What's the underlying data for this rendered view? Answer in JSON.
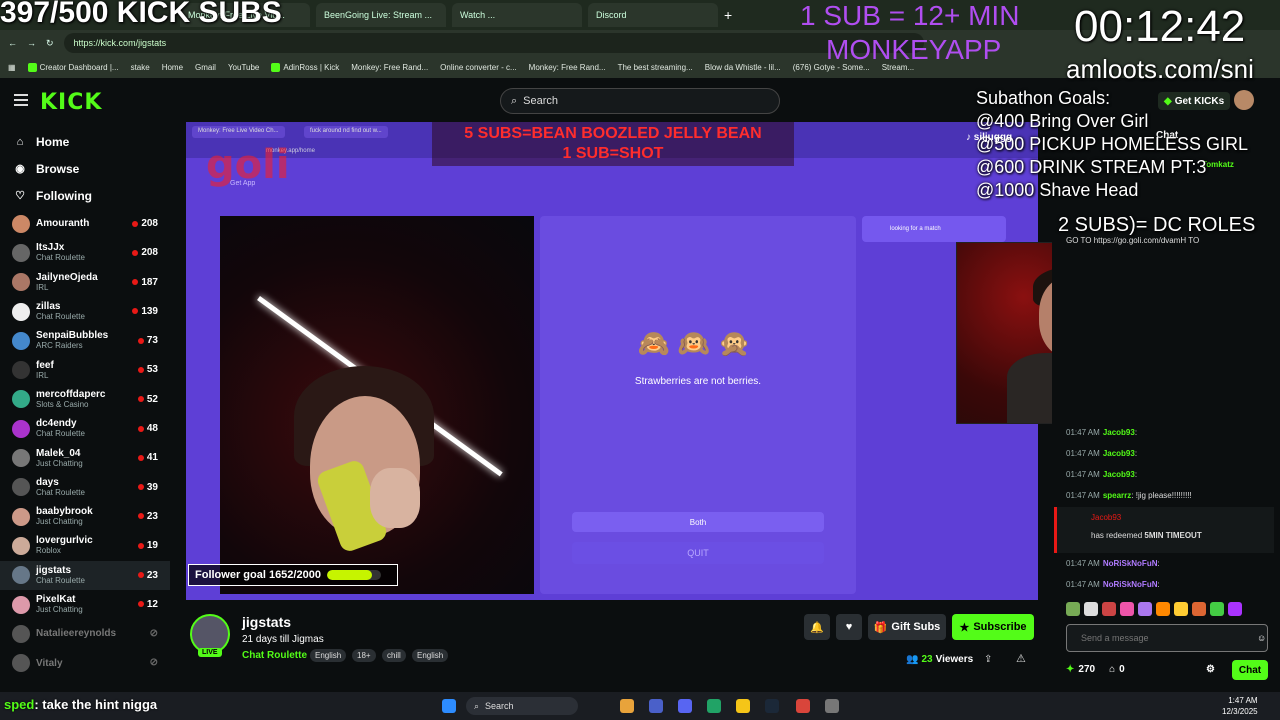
{
  "browser": {
    "tabs": [
      "Monkey: Free Live Vid...",
      "BeenGoing Live: Stream ...",
      "Watch ...",
      "Discord"
    ],
    "url": "https://kick.com/jigstats",
    "bookmarks": [
      "Creator Dashboard |...",
      "stake",
      "Home",
      "Gmail",
      "YouTube",
      "AdinRoss | Kick",
      "Monkey: Free Rand...",
      "Online converter - c...",
      "Monkey: Free Rand...",
      "The best streaming...",
      "Blow da Whistle - lil...",
      "(676) Gotye - Some...",
      "Stream..."
    ]
  },
  "overlay": {
    "sub_counter": "397/500 KICK SUBS",
    "sub_rule_line1": "1 SUB = 12+ MIN",
    "sub_rule_line2": "MONKEYAPP",
    "timer": "00:12:42",
    "site": "amloots.com/sni",
    "goals_title": "Subathon Goals:",
    "goals": [
      "@400 Bring Over Girl",
      "@500 PICKUP HOMELESS GIRL",
      "@600 DRINK STREAM PT:3",
      "@1000 Shave Head"
    ],
    "dc_roles": "2 SUBS)= DC ROLES",
    "red_line1": "5 SUBS=BEAN BOOZLED JELLY BEAN",
    "red_line2": "1 SUB=SHOT",
    "goli": "goli",
    "follower_goal": "Follower goal 1652/2000",
    "follower_progress": 0.826,
    "bottom_chat_user": "sped",
    "bottom_chat_msg": ": take the hint nigga"
  },
  "topnav": {
    "logo": "KICK",
    "search_placeholder": "Search",
    "get_kicks": "Get KICKs"
  },
  "sidebar": {
    "nav": [
      {
        "label": "Home",
        "icon": "⌂"
      },
      {
        "label": "Browse",
        "icon": "◉"
      },
      {
        "label": "Following",
        "icon": "♡"
      }
    ],
    "channels": [
      {
        "name": "Amouranth",
        "cat": "",
        "viewers": "208",
        "color": "#c86"
      },
      {
        "name": "ItsJJx",
        "cat": "Chat Roulette",
        "viewers": "208",
        "color": "#666"
      },
      {
        "name": "JailyneOjeda",
        "cat": "IRL",
        "viewers": "187",
        "color": "#a76"
      },
      {
        "name": "zillas",
        "cat": "Chat Roulette",
        "viewers": "139",
        "color": "#eee"
      },
      {
        "name": "SenpaiBubbles",
        "cat": "ARC Raiders",
        "viewers": "73",
        "color": "#48c"
      },
      {
        "name": "feef",
        "cat": "IRL",
        "viewers": "53",
        "color": "#333"
      },
      {
        "name": "mercoffdaperc",
        "cat": "Slots & Casino",
        "viewers": "52",
        "color": "#3a8"
      },
      {
        "name": "dc4endy",
        "cat": "Chat Roulette",
        "viewers": "48",
        "color": "#a3c"
      },
      {
        "name": "Malek_04",
        "cat": "Just Chatting",
        "viewers": "41",
        "color": "#777"
      },
      {
        "name": "days",
        "cat": "Chat Roulette",
        "viewers": "39",
        "color": "#555"
      },
      {
        "name": "baabybrook",
        "cat": "Just Chatting",
        "viewers": "23",
        "color": "#c98"
      },
      {
        "name": "lovergurlvic",
        "cat": "Roblox",
        "viewers": "19",
        "color": "#ca9"
      },
      {
        "name": "jigstats",
        "cat": "Chat Roulette",
        "viewers": "23",
        "color": "#678"
      },
      {
        "name": "PixelKat",
        "cat": "Just Chatting",
        "viewers": "12",
        "color": "#d9a"
      },
      {
        "name": "Natalieereynolds",
        "cat": "",
        "viewers": "",
        "color": "#555"
      },
      {
        "name": "Vitaly",
        "cat": "",
        "viewers": "",
        "color": "#555"
      }
    ]
  },
  "player": {
    "inner_tabs": [
      "Monkey: Free Live Video Ch...",
      "fuck around nd find out w..."
    ],
    "inner_url": "monkey.app/home",
    "get_app": "Get App",
    "looking": "looking for a match",
    "emojis": "🙈🙉🙊",
    "fact": "Strawberries are not berries.",
    "both": "Both",
    "quit": "QUIT"
  },
  "stream": {
    "name": "jigstats",
    "title": "21 days till Jigmas",
    "category": "Chat Roulette",
    "tags": [
      "English",
      "18+",
      "chill",
      "English"
    ],
    "live": "LIVE",
    "gift_subs": "Gift Subs",
    "subscribe": "Subscribe",
    "viewers": "23",
    "viewers_label": "Viewers"
  },
  "chat": {
    "header": "Chat",
    "tiktok_user": "siljuggg",
    "top_user": "Tomkatz",
    "top_link": "GO TO https://go.goli.com/dvamH TO",
    "lines": [
      {
        "time": "01:47 AM",
        "user": "Jacob93",
        "msg": ""
      },
      {
        "time": "01:47 AM",
        "user": "Jacob93",
        "msg": ""
      },
      {
        "time": "01:47 AM",
        "user": "Jacob93",
        "msg": ""
      },
      {
        "time": "01:47 AM",
        "user": "spearrz",
        "msg": "!jig please!!!!!!!!!"
      }
    ],
    "redeem_user": "Jacob93",
    "redeem_text_prefix": "has redeemed ",
    "redeem_reward": "5MIN TIMEOUT",
    "lines2": [
      {
        "time": "01:47 AM",
        "user": "NoRiSkNoFuN",
        "msg": ""
      },
      {
        "time": "01:47 AM",
        "user": "NoRiSkNoFuN",
        "msg": ""
      }
    ],
    "placeholder": "Send a message",
    "points": "270",
    "cart": "0",
    "chat_button": "Chat"
  },
  "taskbar": {
    "search": "Search",
    "time": "1:47 AM",
    "date": "12/3/2025"
  }
}
